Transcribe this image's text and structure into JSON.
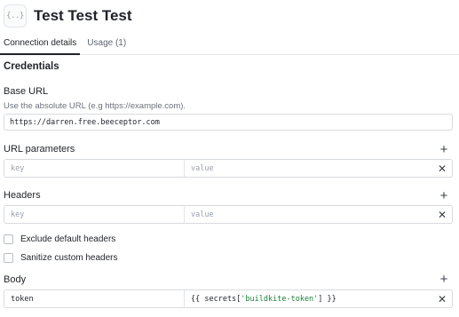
{
  "header": {
    "title": "Test Test Test",
    "icon": "code-braces-icon",
    "icon_glyph": "{..}"
  },
  "tabs": [
    {
      "label": "Connection details",
      "active": true
    },
    {
      "label": "Usage (1)",
      "active": false
    }
  ],
  "credentials": {
    "title": "Credentials",
    "base_url": {
      "label": "Base URL",
      "help": "Use the absolute URL (e.g https://example.com).",
      "value": "https://darren.free.beeceptor.com"
    },
    "url_parameters": {
      "label": "URL parameters",
      "rows": [
        {
          "key_placeholder": "key",
          "value_placeholder": "value"
        }
      ]
    },
    "headers": {
      "label": "Headers",
      "rows": [
        {
          "key_placeholder": "key",
          "value_placeholder": "value"
        }
      ]
    },
    "options": [
      {
        "label": "Exclude default headers",
        "checked": false
      },
      {
        "label": "Sanitize custom headers",
        "checked": false
      }
    ],
    "body": {
      "label": "Body",
      "rows": [
        {
          "key": "token",
          "value_prefix": "{{ secrets[",
          "value_string": "'buildkite-token'",
          "value_suffix": "] }}"
        }
      ]
    }
  },
  "icons": {
    "plus": "+",
    "close": "✕"
  },
  "colors": {
    "accent": "#1f2328",
    "string": "#1a7f37",
    "border": "#d8dbdf"
  }
}
